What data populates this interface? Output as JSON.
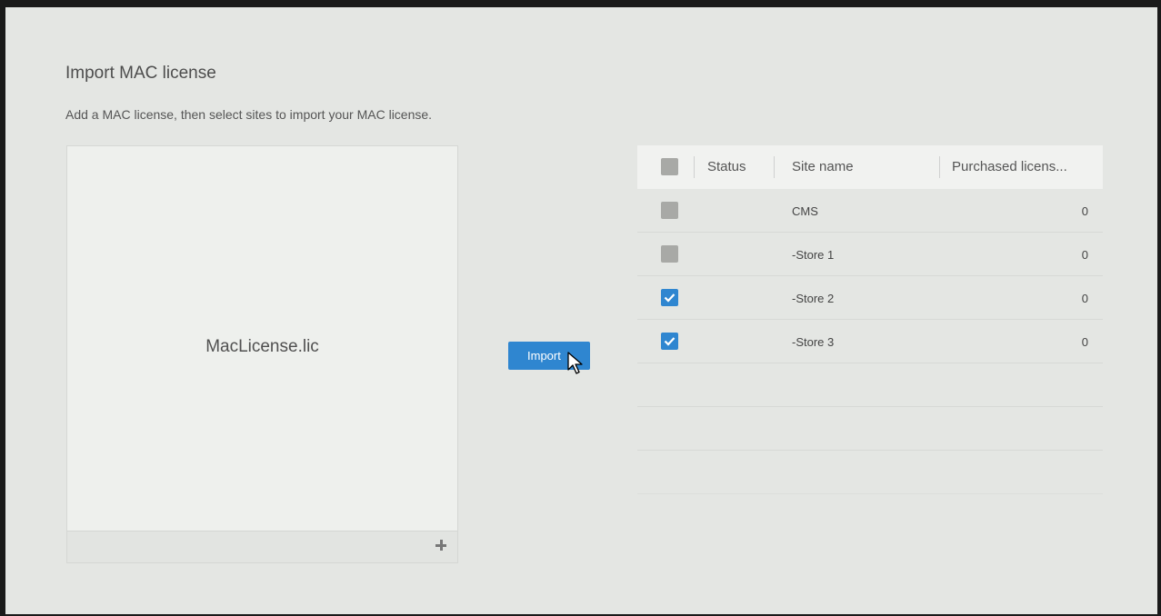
{
  "dialog": {
    "title": "Import MAC license",
    "subtitle": "Add a MAC license, then select sites to import your MAC license."
  },
  "file_panel": {
    "file_name": "MacLicense.lic",
    "add_icon": "plus-icon"
  },
  "import_button": {
    "label": "Import"
  },
  "table": {
    "columns": [
      "Status",
      "Site name",
      "Purchased licens..."
    ],
    "rows": [
      {
        "site": "CMS",
        "purchased": "0",
        "checked": false
      },
      {
        "site": "-Store 1",
        "purchased": "0",
        "checked": false
      },
      {
        "site": "-Store 2",
        "purchased": "0",
        "checked": true
      },
      {
        "site": "-Store 3",
        "purchased": "0",
        "checked": true
      }
    ],
    "select_all_checked": false
  },
  "colors": {
    "accent": "#2f86d0",
    "background": "#e4e6e3",
    "checkbox_off": "#a8a9a6"
  }
}
